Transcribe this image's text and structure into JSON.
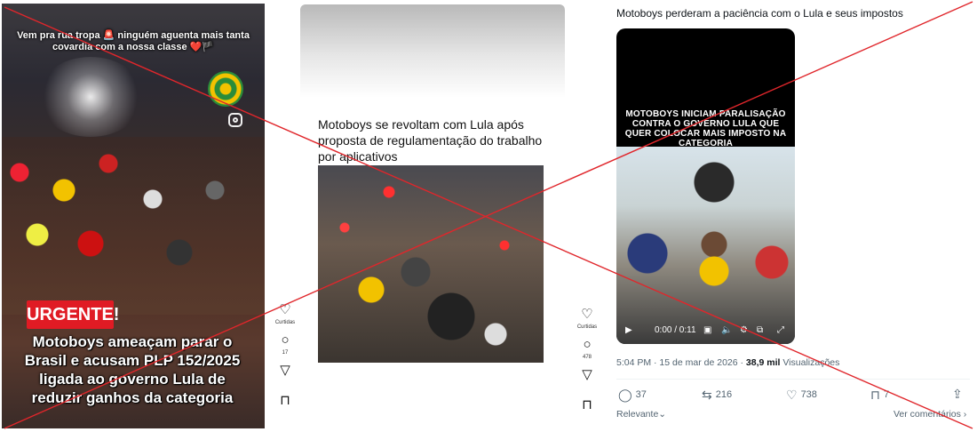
{
  "post1": {
    "caption": "Vem pra rua tropa 🚨 ninguém aguenta mais tanta covardia com a nossa classe ❤️🏴",
    "badge": "URGENTE!",
    "headline": "Motoboys ameaçam parar o Brasil e acusam PLP 152/2025 ligada ao governo Lula de reduzir ganhos da categoria",
    "sidebar": {
      "likes_label": "Curtidas",
      "comments": "17"
    }
  },
  "post2": {
    "headline": "Motoboys se revoltam com Lula após proposta de regulamentação do trabalho por aplicativos",
    "sidebar": {
      "likes_label": "Curtidas",
      "comments": "478"
    }
  },
  "post3": {
    "title": "Motoboys perderam a paciência com o Lula e seus impostos",
    "video_overlay": "MOTOBOYS INICIAM PARALISAÇÃO CONTRA O GOVERNO LULA QUE QUER COLOCAR MAIS IMPOSTO NA CATEGORIA",
    "video_time": "0:00 / 0:11",
    "timestamp": "5:04 PM · 15 de mar de 2026 · ",
    "views_count": "38,9 mil",
    "views_label": " Visualizações",
    "replies": "37",
    "reposts": "216",
    "likes": "738",
    "bookmarks": "7",
    "relevance": "Relevante",
    "see_comments": "Ver comentários"
  },
  "overlay": {
    "cross_color": "#e0262b"
  }
}
